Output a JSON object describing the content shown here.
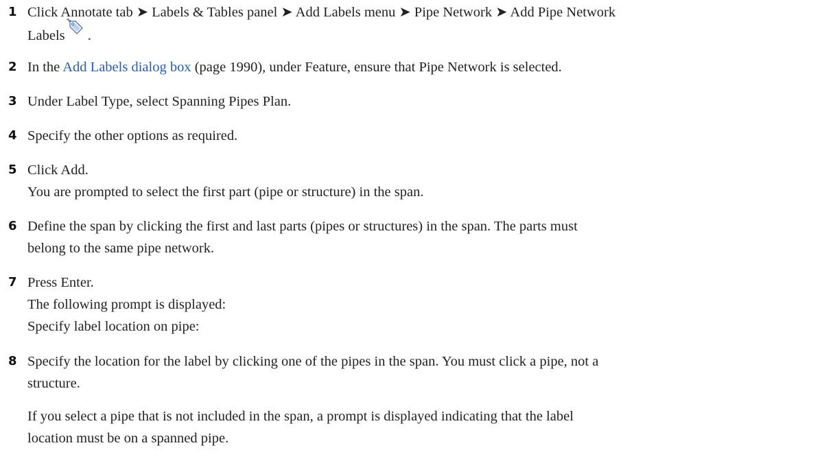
{
  "steps": [
    {
      "number": "1",
      "line1": "Click Annotate tab ➤ Labels & Tables panel ➤ Add Labels menu ➤ Pipe Network ➤ Add Pipe Network",
      "line2_text": "Labels",
      "line2_end": " .",
      "icon": "add-pipe-network-labels-icon"
    },
    {
      "number": "2",
      "pre": "In the ",
      "link": "Add Labels dialog box",
      "post": " (page 1990), under Feature, ensure that Pipe Network is selected."
    },
    {
      "number": "3",
      "text": "Under Label Type, select Spanning Pipes Plan."
    },
    {
      "number": "4",
      "text": "Specify the other options as required."
    },
    {
      "number": "5",
      "text": "Click Add.",
      "note": "You are prompted to select the first part (pipe or structure) in the span."
    },
    {
      "number": "6",
      "line1": "Define the span by clicking the first and last parts (pipes or structures) in the span. The parts must",
      "line2": "belong to the same pipe network."
    },
    {
      "number": "7",
      "text": "Press Enter.",
      "note1": "The following prompt is displayed:",
      "note2": "Specify label location on pipe:"
    },
    {
      "number": "8",
      "line1": "Specify the location for the label by clicking one of the pipes in the span. You must click a pipe, not a",
      "line2": "structure.",
      "note_line1": "If you select a pipe that is not included in the span, a prompt is displayed indicating that the label",
      "note_line2": "location must be on a spanned pipe."
    }
  ],
  "colors": {
    "text": "#222222",
    "link": "#2a5db0"
  }
}
